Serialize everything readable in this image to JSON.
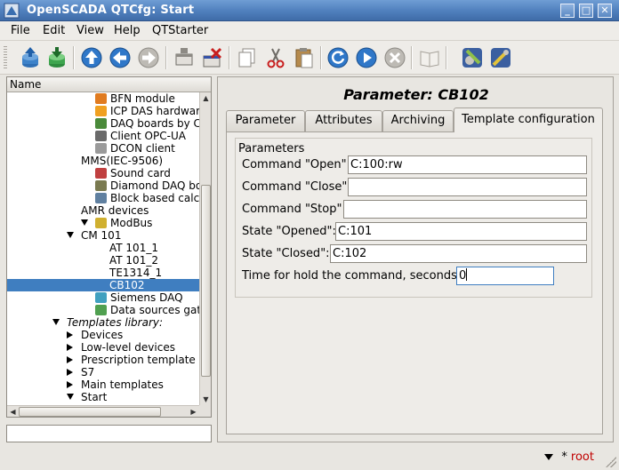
{
  "window": {
    "title": "OpenSCADA QTCfg: Start",
    "buttons": {
      "minimize": "_",
      "maximize": "□",
      "close": "✕"
    }
  },
  "menu": [
    "File",
    "Edit",
    "View",
    "Help",
    "QTStarter"
  ],
  "toolbar": {
    "icons": [
      "db-load-icon",
      "db-save-icon",
      "up-icon",
      "back-icon",
      "forward-icon",
      "add-item-icon",
      "delete-item-icon",
      "copy-icon",
      "cut-icon",
      "paste-icon",
      "refresh-icon",
      "start-icon",
      "stop-icon",
      "manual-icon",
      "gear-wrench-icon",
      "wrench-icon"
    ]
  },
  "tree": {
    "header": "Name",
    "rows": [
      {
        "label": "BFN module",
        "indent": 6,
        "icon": "bfn-icon",
        "arrow": ""
      },
      {
        "label": "ICP DAS hardware",
        "indent": 6,
        "icon": "icp-das-icon",
        "arrow": ""
      },
      {
        "label": "DAQ boards by Co",
        "indent": 6,
        "icon": "daq-board-icon",
        "arrow": ""
      },
      {
        "label": "Client OPC-UA",
        "indent": 6,
        "icon": "opc-ua-icon",
        "arrow": ""
      },
      {
        "label": "DCON client",
        "indent": 6,
        "icon": "dcon-icon",
        "arrow": ""
      },
      {
        "label": "MMS(IEC-9506)",
        "indent": 5,
        "icon": "",
        "arrow": ""
      },
      {
        "label": "Sound card",
        "indent": 6,
        "icon": "sound-card-icon",
        "arrow": ""
      },
      {
        "label": "Diamond DAQ boa",
        "indent": 6,
        "icon": "diamond-daq-icon",
        "arrow": ""
      },
      {
        "label": "Block based calcu",
        "indent": 6,
        "icon": "block-calc-icon",
        "arrow": ""
      },
      {
        "label": "AMR devices",
        "indent": 5,
        "icon": "",
        "arrow": ""
      },
      {
        "label": "ModBus",
        "indent": 6,
        "icon": "modbus-icon",
        "arrow": "down"
      },
      {
        "label": "CM 101",
        "indent": 5,
        "icon": "",
        "arrow": "down",
        "level": 2
      },
      {
        "label": "AT 101_1",
        "indent": 7,
        "icon": "",
        "arrow": ""
      },
      {
        "label": "AT 101_2",
        "indent": 7,
        "icon": "",
        "arrow": ""
      },
      {
        "label": "TE1314_1",
        "indent": 7,
        "icon": "",
        "arrow": ""
      },
      {
        "label": "CB102",
        "indent": 7,
        "icon": "",
        "arrow": "",
        "selected": true
      },
      {
        "label": "Siemens DAQ",
        "indent": 6,
        "icon": "siemens-icon",
        "arrow": ""
      },
      {
        "label": "Data sources gate",
        "indent": 6,
        "icon": "data-gate-icon",
        "arrow": ""
      },
      {
        "label": "Templates library:",
        "indent": 4,
        "icon": "",
        "arrow": "down",
        "italic": true
      },
      {
        "label": "Devices",
        "indent": 5,
        "icon": "",
        "arrow": "right"
      },
      {
        "label": "Low-level devices",
        "indent": 5,
        "icon": "",
        "arrow": "right"
      },
      {
        "label": "Prescription template",
        "indent": 5,
        "icon": "",
        "arrow": "right"
      },
      {
        "label": "S7",
        "indent": 5,
        "icon": "",
        "arrow": "right"
      },
      {
        "label": "Main templates",
        "indent": 5,
        "icon": "",
        "arrow": "right"
      },
      {
        "label": "Start",
        "indent": 5,
        "icon": "",
        "arrow": "down"
      }
    ]
  },
  "bottom_input": {
    "value": ""
  },
  "panel": {
    "title": "Parameter: CB102",
    "tabs": [
      {
        "label": "Parameter",
        "active": false
      },
      {
        "label": "Attributes",
        "active": false
      },
      {
        "label": "Archiving",
        "active": false
      },
      {
        "label": "Template configuration",
        "active": true
      }
    ],
    "group_title": "Parameters",
    "params": [
      {
        "label": "Command \"Open\":",
        "value": "C:100:rw"
      },
      {
        "label": "Command \"Close\":",
        "value": ""
      },
      {
        "label": "Command \"Stop\":",
        "value": ""
      },
      {
        "label": "State \"Opened\":",
        "value": "C:101"
      },
      {
        "label": "State \"Closed\":",
        "value": "C:102"
      },
      {
        "label": "Time for hold the command, seconds:",
        "value": "0"
      }
    ]
  },
  "status": {
    "star": "*",
    "user": "root"
  }
}
